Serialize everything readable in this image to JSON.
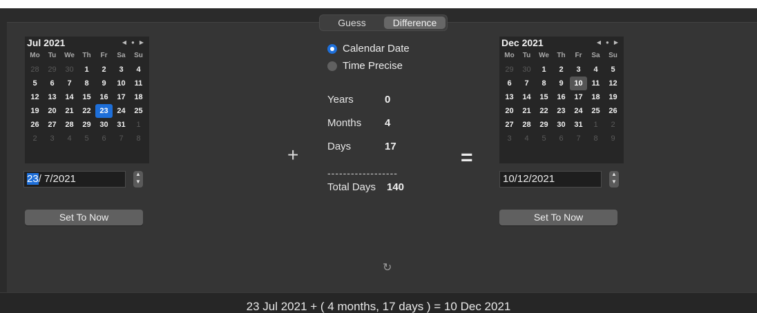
{
  "tabs": [
    {
      "label": "Guess",
      "active": false
    },
    {
      "label": "Difference",
      "active": true
    }
  ],
  "calendar_left": {
    "title": "Jul 2021",
    "weekdays": [
      "Mo",
      "Tu",
      "We",
      "Th",
      "Fr",
      "Sa",
      "Su"
    ],
    "weeks": [
      [
        [
          "28",
          1
        ],
        [
          "29",
          1
        ],
        [
          "30",
          1
        ],
        [
          "1",
          0
        ],
        [
          "2",
          0
        ],
        [
          "3",
          0
        ],
        [
          "4",
          0
        ]
      ],
      [
        [
          "5",
          0
        ],
        [
          "6",
          0
        ],
        [
          "7",
          0
        ],
        [
          "8",
          0
        ],
        [
          "9",
          0
        ],
        [
          "10",
          0
        ],
        [
          "11",
          0
        ]
      ],
      [
        [
          "12",
          0
        ],
        [
          "13",
          0
        ],
        [
          "14",
          0
        ],
        [
          "15",
          0
        ],
        [
          "16",
          0
        ],
        [
          "17",
          0
        ],
        [
          "18",
          0
        ]
      ],
      [
        [
          "19",
          0
        ],
        [
          "20",
          0
        ],
        [
          "21",
          0
        ],
        [
          "22",
          0
        ],
        [
          "23",
          2
        ],
        [
          "24",
          0
        ],
        [
          "25",
          0
        ]
      ],
      [
        [
          "26",
          0
        ],
        [
          "27",
          0
        ],
        [
          "28",
          0
        ],
        [
          "29",
          0
        ],
        [
          "30",
          0
        ],
        [
          "31",
          0
        ],
        [
          "1",
          1
        ]
      ],
      [
        [
          "2",
          1
        ],
        [
          "3",
          1
        ],
        [
          "4",
          1
        ],
        [
          "5",
          1
        ],
        [
          "6",
          1
        ],
        [
          "7",
          1
        ],
        [
          "8",
          1
        ]
      ]
    ]
  },
  "calendar_right": {
    "title": "Dec 2021",
    "weekdays": [
      "Mo",
      "Tu",
      "We",
      "Th",
      "Fr",
      "Sa",
      "Su"
    ],
    "weeks": [
      [
        [
          "29",
          1
        ],
        [
          "30",
          1
        ],
        [
          "1",
          0
        ],
        [
          "2",
          0
        ],
        [
          "3",
          0
        ],
        [
          "4",
          0
        ],
        [
          "5",
          0
        ]
      ],
      [
        [
          "6",
          0
        ],
        [
          "7",
          0
        ],
        [
          "8",
          0
        ],
        [
          "9",
          0
        ],
        [
          "10",
          3
        ],
        [
          "11",
          0
        ],
        [
          "12",
          0
        ]
      ],
      [
        [
          "13",
          0
        ],
        [
          "14",
          0
        ],
        [
          "15",
          0
        ],
        [
          "16",
          0
        ],
        [
          "17",
          0
        ],
        [
          "18",
          0
        ],
        [
          "19",
          0
        ]
      ],
      [
        [
          "20",
          0
        ],
        [
          "21",
          0
        ],
        [
          "22",
          0
        ],
        [
          "23",
          0
        ],
        [
          "24",
          0
        ],
        [
          "25",
          0
        ],
        [
          "26",
          0
        ]
      ],
      [
        [
          "27",
          0
        ],
        [
          "28",
          0
        ],
        [
          "29",
          0
        ],
        [
          "30",
          0
        ],
        [
          "31",
          0
        ],
        [
          "1",
          1
        ],
        [
          "2",
          1
        ]
      ],
      [
        [
          "3",
          1
        ],
        [
          "4",
          1
        ],
        [
          "5",
          1
        ],
        [
          "6",
          1
        ],
        [
          "7",
          1
        ],
        [
          "8",
          1
        ],
        [
          "9",
          1
        ]
      ]
    ]
  },
  "nav_glyphs": {
    "prev": "◀",
    "today": "●",
    "next": "▶"
  },
  "start_date": {
    "day": "23",
    "rest": "/ 7/2021"
  },
  "end_date": {
    "value": "10/12/2021"
  },
  "set_to_now_label": "Set To Now",
  "options": {
    "calendar_date": "Calendar Date",
    "time_precise": "Time Precise",
    "selected": "calendar_date"
  },
  "stats": {
    "years_label": "Years",
    "years": "0",
    "months_label": "Months",
    "months": "4",
    "days_label": "Days",
    "days": "17",
    "separator": "------------------",
    "total_label": "Total Days",
    "total": "140"
  },
  "operators": {
    "plus": "+",
    "equals": "="
  },
  "refresh_glyph": "↻",
  "summary": "23 Jul 2021 + ( 4 months, 17 days ) = 10 Dec 2021",
  "colors": {
    "accent": "#1e6fd9",
    "background": "#353535",
    "calendar_bg": "#262626"
  }
}
